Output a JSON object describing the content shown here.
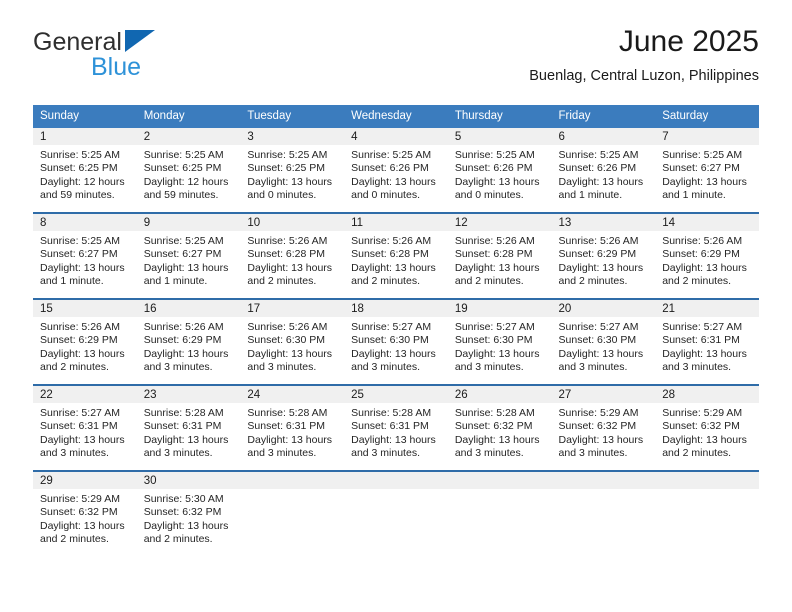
{
  "brand": {
    "name_part1": "General",
    "name_part2": "Blue",
    "triangle_color": "#1167b1",
    "blue_text_color": "#2e92d8"
  },
  "header": {
    "title": "June 2025",
    "subtitle": "Buenlag, Central Luzon, Philippines"
  },
  "theme": {
    "header_blue": "#3b7cbe",
    "row_divider_blue": "#2f6ca8",
    "daynum_band": "#f0f0f0"
  },
  "weekday_headers": [
    "Sunday",
    "Monday",
    "Tuesday",
    "Wednesday",
    "Thursday",
    "Friday",
    "Saturday"
  ],
  "labels": {
    "sunrise_prefix": "Sunrise: ",
    "sunset_prefix": "Sunset: ",
    "daylight_prefix": "Daylight: "
  },
  "weeks": [
    [
      {
        "day": "1",
        "sunrise": "Sunrise: 5:25 AM",
        "sunset": "Sunset: 6:25 PM",
        "daylight_line1": "Daylight: 12 hours",
        "daylight_line2": "and 59 minutes."
      },
      {
        "day": "2",
        "sunrise": "Sunrise: 5:25 AM",
        "sunset": "Sunset: 6:25 PM",
        "daylight_line1": "Daylight: 12 hours",
        "daylight_line2": "and 59 minutes."
      },
      {
        "day": "3",
        "sunrise": "Sunrise: 5:25 AM",
        "sunset": "Sunset: 6:25 PM",
        "daylight_line1": "Daylight: 13 hours",
        "daylight_line2": "and 0 minutes."
      },
      {
        "day": "4",
        "sunrise": "Sunrise: 5:25 AM",
        "sunset": "Sunset: 6:26 PM",
        "daylight_line1": "Daylight: 13 hours",
        "daylight_line2": "and 0 minutes."
      },
      {
        "day": "5",
        "sunrise": "Sunrise: 5:25 AM",
        "sunset": "Sunset: 6:26 PM",
        "daylight_line1": "Daylight: 13 hours",
        "daylight_line2": "and 0 minutes."
      },
      {
        "day": "6",
        "sunrise": "Sunrise: 5:25 AM",
        "sunset": "Sunset: 6:26 PM",
        "daylight_line1": "Daylight: 13 hours",
        "daylight_line2": "and 1 minute."
      },
      {
        "day": "7",
        "sunrise": "Sunrise: 5:25 AM",
        "sunset": "Sunset: 6:27 PM",
        "daylight_line1": "Daylight: 13 hours",
        "daylight_line2": "and 1 minute."
      }
    ],
    [
      {
        "day": "8",
        "sunrise": "Sunrise: 5:25 AM",
        "sunset": "Sunset: 6:27 PM",
        "daylight_line1": "Daylight: 13 hours",
        "daylight_line2": "and 1 minute."
      },
      {
        "day": "9",
        "sunrise": "Sunrise: 5:25 AM",
        "sunset": "Sunset: 6:27 PM",
        "daylight_line1": "Daylight: 13 hours",
        "daylight_line2": "and 1 minute."
      },
      {
        "day": "10",
        "sunrise": "Sunrise: 5:26 AM",
        "sunset": "Sunset: 6:28 PM",
        "daylight_line1": "Daylight: 13 hours",
        "daylight_line2": "and 2 minutes."
      },
      {
        "day": "11",
        "sunrise": "Sunrise: 5:26 AM",
        "sunset": "Sunset: 6:28 PM",
        "daylight_line1": "Daylight: 13 hours",
        "daylight_line2": "and 2 minutes."
      },
      {
        "day": "12",
        "sunrise": "Sunrise: 5:26 AM",
        "sunset": "Sunset: 6:28 PM",
        "daylight_line1": "Daylight: 13 hours",
        "daylight_line2": "and 2 minutes."
      },
      {
        "day": "13",
        "sunrise": "Sunrise: 5:26 AM",
        "sunset": "Sunset: 6:29 PM",
        "daylight_line1": "Daylight: 13 hours",
        "daylight_line2": "and 2 minutes."
      },
      {
        "day": "14",
        "sunrise": "Sunrise: 5:26 AM",
        "sunset": "Sunset: 6:29 PM",
        "daylight_line1": "Daylight: 13 hours",
        "daylight_line2": "and 2 minutes."
      }
    ],
    [
      {
        "day": "15",
        "sunrise": "Sunrise: 5:26 AM",
        "sunset": "Sunset: 6:29 PM",
        "daylight_line1": "Daylight: 13 hours",
        "daylight_line2": "and 2 minutes."
      },
      {
        "day": "16",
        "sunrise": "Sunrise: 5:26 AM",
        "sunset": "Sunset: 6:29 PM",
        "daylight_line1": "Daylight: 13 hours",
        "daylight_line2": "and 3 minutes."
      },
      {
        "day": "17",
        "sunrise": "Sunrise: 5:26 AM",
        "sunset": "Sunset: 6:30 PM",
        "daylight_line1": "Daylight: 13 hours",
        "daylight_line2": "and 3 minutes."
      },
      {
        "day": "18",
        "sunrise": "Sunrise: 5:27 AM",
        "sunset": "Sunset: 6:30 PM",
        "daylight_line1": "Daylight: 13 hours",
        "daylight_line2": "and 3 minutes."
      },
      {
        "day": "19",
        "sunrise": "Sunrise: 5:27 AM",
        "sunset": "Sunset: 6:30 PM",
        "daylight_line1": "Daylight: 13 hours",
        "daylight_line2": "and 3 minutes."
      },
      {
        "day": "20",
        "sunrise": "Sunrise: 5:27 AM",
        "sunset": "Sunset: 6:30 PM",
        "daylight_line1": "Daylight: 13 hours",
        "daylight_line2": "and 3 minutes."
      },
      {
        "day": "21",
        "sunrise": "Sunrise: 5:27 AM",
        "sunset": "Sunset: 6:31 PM",
        "daylight_line1": "Daylight: 13 hours",
        "daylight_line2": "and 3 minutes."
      }
    ],
    [
      {
        "day": "22",
        "sunrise": "Sunrise: 5:27 AM",
        "sunset": "Sunset: 6:31 PM",
        "daylight_line1": "Daylight: 13 hours",
        "daylight_line2": "and 3 minutes."
      },
      {
        "day": "23",
        "sunrise": "Sunrise: 5:28 AM",
        "sunset": "Sunset: 6:31 PM",
        "daylight_line1": "Daylight: 13 hours",
        "daylight_line2": "and 3 minutes."
      },
      {
        "day": "24",
        "sunrise": "Sunrise: 5:28 AM",
        "sunset": "Sunset: 6:31 PM",
        "daylight_line1": "Daylight: 13 hours",
        "daylight_line2": "and 3 minutes."
      },
      {
        "day": "25",
        "sunrise": "Sunrise: 5:28 AM",
        "sunset": "Sunset: 6:31 PM",
        "daylight_line1": "Daylight: 13 hours",
        "daylight_line2": "and 3 minutes."
      },
      {
        "day": "26",
        "sunrise": "Sunrise: 5:28 AM",
        "sunset": "Sunset: 6:32 PM",
        "daylight_line1": "Daylight: 13 hours",
        "daylight_line2": "and 3 minutes."
      },
      {
        "day": "27",
        "sunrise": "Sunrise: 5:29 AM",
        "sunset": "Sunset: 6:32 PM",
        "daylight_line1": "Daylight: 13 hours",
        "daylight_line2": "and 3 minutes."
      },
      {
        "day": "28",
        "sunrise": "Sunrise: 5:29 AM",
        "sunset": "Sunset: 6:32 PM",
        "daylight_line1": "Daylight: 13 hours",
        "daylight_line2": "and 2 minutes."
      }
    ],
    [
      {
        "day": "29",
        "sunrise": "Sunrise: 5:29 AM",
        "sunset": "Sunset: 6:32 PM",
        "daylight_line1": "Daylight: 13 hours",
        "daylight_line2": "and 2 minutes."
      },
      {
        "day": "30",
        "sunrise": "Sunrise: 5:30 AM",
        "sunset": "Sunset: 6:32 PM",
        "daylight_line1": "Daylight: 13 hours",
        "daylight_line2": "and 2 minutes."
      },
      {
        "day": "",
        "sunrise": "",
        "sunset": "",
        "daylight_line1": "",
        "daylight_line2": ""
      },
      {
        "day": "",
        "sunrise": "",
        "sunset": "",
        "daylight_line1": "",
        "daylight_line2": ""
      },
      {
        "day": "",
        "sunrise": "",
        "sunset": "",
        "daylight_line1": "",
        "daylight_line2": ""
      },
      {
        "day": "",
        "sunrise": "",
        "sunset": "",
        "daylight_line1": "",
        "daylight_line2": ""
      },
      {
        "day": "",
        "sunrise": "",
        "sunset": "",
        "daylight_line1": "",
        "daylight_line2": ""
      }
    ]
  ]
}
